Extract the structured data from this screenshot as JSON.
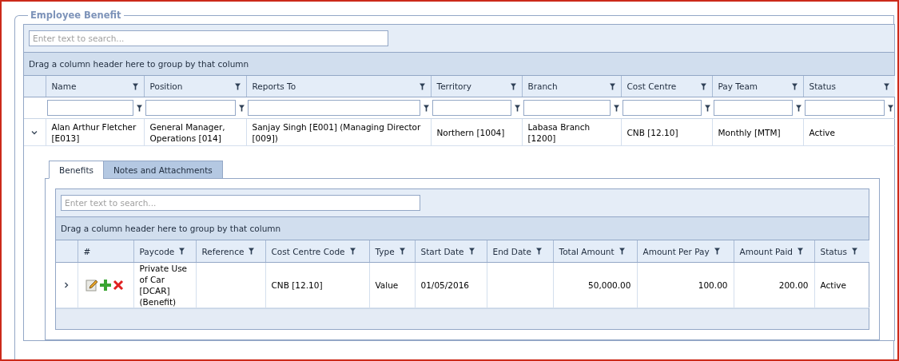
{
  "fieldset": {
    "legend": "Employee Benefit"
  },
  "grid": {
    "search": {
      "placeholder": "Enter text to search..."
    },
    "group_panel": "Drag a column header here to group by that column",
    "columns": [
      {
        "label": "Name"
      },
      {
        "label": "Position"
      },
      {
        "label": "Reports To"
      },
      {
        "label": "Territory"
      },
      {
        "label": "Branch"
      },
      {
        "label": "Cost Centre"
      },
      {
        "label": "Pay Team"
      },
      {
        "label": "Status"
      }
    ],
    "rows": [
      {
        "expanded": true,
        "cells": [
          "Alan Arthur Fletcher [E013]",
          "General Manager, Operations [014]",
          "Sanjay Singh [E001] (Managing Director [009])",
          "Northern [1004]",
          "Labasa Branch [1200]",
          "CNB [12.10]",
          "Monthly [MTM]",
          "Active"
        ]
      }
    ]
  },
  "detail": {
    "tabs": [
      {
        "label": "Benefits",
        "selected": true
      },
      {
        "label": "Notes and Attachments",
        "selected": false
      }
    ],
    "grid": {
      "search": {
        "placeholder": "Enter text to search..."
      },
      "group_panel": "Drag a column header here to group by that column",
      "columns": [
        {
          "label": "#",
          "kind": "actions"
        },
        {
          "label": "Paycode",
          "kind": "text"
        },
        {
          "label": "Reference",
          "kind": "text"
        },
        {
          "label": "Cost Centre Code",
          "kind": "text"
        },
        {
          "label": "Type",
          "kind": "text"
        },
        {
          "label": "Start Date",
          "kind": "text"
        },
        {
          "label": "End Date",
          "kind": "text"
        },
        {
          "label": "Total Amount",
          "kind": "number"
        },
        {
          "label": "Amount Per Pay",
          "kind": "number"
        },
        {
          "label": "Amount Paid",
          "kind": "number"
        },
        {
          "label": "Status",
          "kind": "text"
        }
      ],
      "rows": [
        {
          "expanded": false,
          "cells": [
            null,
            "Private Use of Car [DCAR] (Benefit)",
            null,
            "CNB [12.10]",
            "Value",
            "01/05/2016",
            null,
            "50,000.00",
            "100.00",
            "200.00",
            "Active"
          ]
        }
      ]
    }
  }
}
